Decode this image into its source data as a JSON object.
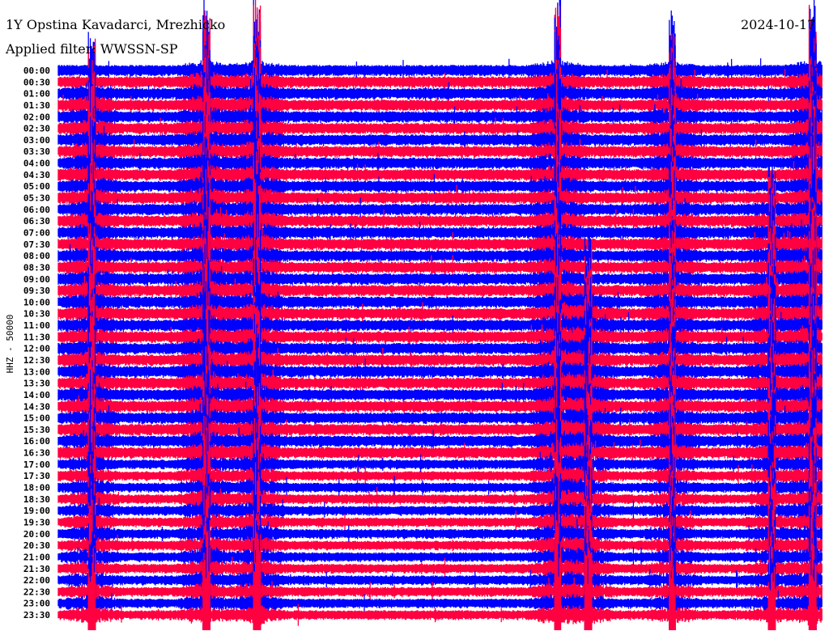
{
  "header": {
    "station": "1Y Opstina Kavadarci, Mrezhicko",
    "date": "2024-10-17",
    "filter": "Applied filter: WWSSN-SP"
  },
  "chart_data": {
    "type": "line",
    "subtype": "helicorder",
    "ylabel": "HHZ - 50000",
    "row_minutes": 30,
    "colors": [
      "#0000ff",
      "#ff0040"
    ],
    "row_labels": [
      "00:00",
      "00:30",
      "01:00",
      "01:30",
      "02:00",
      "02:30",
      "03:00",
      "03:30",
      "04:00",
      "04:30",
      "05:00",
      "05:30",
      "06:00",
      "06:30",
      "07:00",
      "07:30",
      "08:00",
      "08:30",
      "09:00",
      "09:30",
      "10:00",
      "10:30",
      "11:00",
      "11:30",
      "12:00",
      "12:30",
      "13:00",
      "13:30",
      "14:00",
      "14:30",
      "15:00",
      "15:30",
      "16:00",
      "16:30",
      "17:00",
      "17:30",
      "18:00",
      "18:30",
      "19:00",
      "19:30",
      "20:00",
      "20:30",
      "21:00",
      "21:30",
      "22:00",
      "22:30",
      "23:00",
      "23:30"
    ],
    "events": [
      {
        "row_start": 0,
        "row_end": 48,
        "minute": 5.8,
        "amplitude": 1.0
      },
      {
        "row_start": 0,
        "row_end": 48,
        "minute": 7.8,
        "amplitude": 1.0
      },
      {
        "row_start": 2,
        "row_end": 48,
        "minute": 1.3,
        "amplitude": 0.8
      },
      {
        "row_start": 0,
        "row_end": 48,
        "minute": 19.6,
        "amplitude": 1.0
      },
      {
        "row_start": 0,
        "row_end": 48,
        "minute": 24.1,
        "amplitude": 0.7
      },
      {
        "row_start": 0,
        "row_end": 48,
        "minute": 29.6,
        "amplitude": 0.9
      },
      {
        "row_start": 12,
        "row_end": 48,
        "minute": 28.0,
        "amplitude": 0.6
      },
      {
        "row_start": 20,
        "row_end": 48,
        "minute": 20.8,
        "amplitude": 0.8
      }
    ]
  }
}
